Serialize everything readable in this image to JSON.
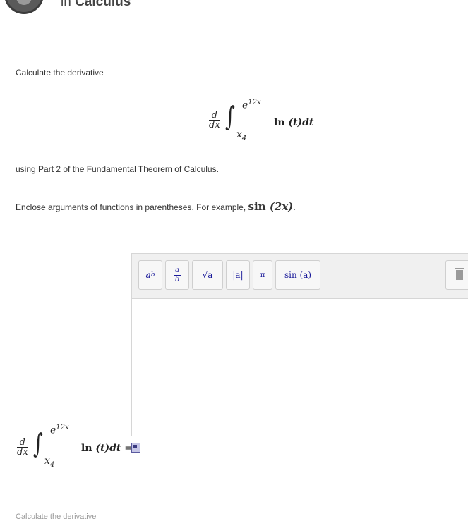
{
  "header": {
    "category_prefix": "in",
    "category_name": "Calculus"
  },
  "question": {
    "intro": "Calculate the derivative",
    "part_text": "using Part 2 of the Fundamental Theorem of Calculus.",
    "hint_text": "Enclose arguments of functions in parentheses. For example,",
    "hint_example_fn": "sin",
    "hint_example_arg": "(2x)",
    "hint_end": "."
  },
  "math": {
    "d": "d",
    "dx": "dx",
    "upper_base": "e",
    "upper_exp": "12x",
    "lower_base": "x",
    "lower_exp": "4",
    "integrand_fn": "ln",
    "integrand_arg": "(t)",
    "integrand_dt": "dt",
    "equals": "="
  },
  "toolbar": {
    "power_base": "a",
    "power_exp": "b",
    "frac_num": "a",
    "frac_den": "b",
    "sqrt_label": "√a",
    "abs_label": "|a|",
    "pi_label": "π",
    "sin_label": "sin (a)"
  },
  "footer": {
    "faded_text": "Calculate the derivative"
  }
}
